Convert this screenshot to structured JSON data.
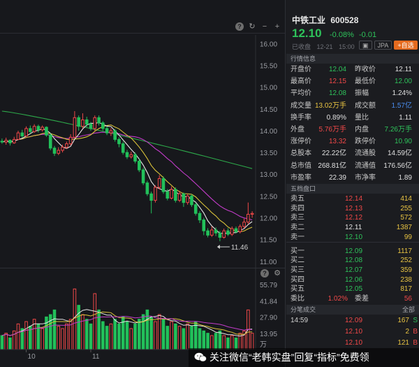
{
  "stock": {
    "name": "中铁工业",
    "code": "600528",
    "price": "12.10",
    "change_pct": "-0.08%",
    "change": "-0.01",
    "status": "已收盘",
    "date": "12-21",
    "time": "15:00",
    "buttons": [
      "JPA",
      "+自选"
    ]
  },
  "quote": {
    "title": "行情信息",
    "rows": [
      {
        "l1": "开盘价",
        "v1": "12.04",
        "c1": "green",
        "l2": "昨收价",
        "v2": "12.11",
        "c2": "white"
      },
      {
        "l1": "最高价",
        "v1": "12.15",
        "c1": "red",
        "l2": "最低价",
        "v2": "12.00",
        "c2": "green"
      },
      {
        "l1": "平均价",
        "v1": "12.08",
        "c1": "green",
        "l2": "振幅",
        "v2": "1.24%",
        "c2": "white"
      },
      {
        "l1": "成交量",
        "v1": "13.02万手",
        "c1": "yellow",
        "l2": "成交额",
        "v2": "1.57亿",
        "c2": "blue"
      },
      {
        "l1": "换手率",
        "v1": "0.89%",
        "c1": "white",
        "l2": "量比",
        "v2": "1.11",
        "c2": "white"
      },
      {
        "l1": "外盘",
        "v1": "5.76万手",
        "c1": "red",
        "l2": "内盘",
        "v2": "7.26万手",
        "c2": "green"
      },
      {
        "l1": "涨停价",
        "v1": "13.32",
        "c1": "red",
        "l2": "跌停价",
        "v2": "10.90",
        "c2": "green"
      },
      {
        "l1": "总股本",
        "v1": "22.22亿",
        "c1": "white",
        "l2": "流通股",
        "v2": "14.59亿",
        "c2": "white"
      },
      {
        "l1": "总市值",
        "v1": "268.81亿",
        "c1": "white",
        "l2": "流通值",
        "v2": "176.56亿",
        "c2": "white"
      },
      {
        "l1": "市盈率",
        "v1": "22.39",
        "c1": "white",
        "l2": "市净率",
        "v2": "1.89",
        "c2": "white"
      }
    ]
  },
  "orderbook": {
    "title": "五档盘口",
    "sell": [
      {
        "label": "卖五",
        "price": "12.14",
        "color": "red",
        "vol": "414"
      },
      {
        "label": "卖四",
        "price": "12.13",
        "color": "red",
        "vol": "255"
      },
      {
        "label": "卖三",
        "price": "12.12",
        "color": "red",
        "vol": "572"
      },
      {
        "label": "卖二",
        "price": "12.11",
        "color": "white",
        "vol": "1387"
      },
      {
        "label": "卖一",
        "price": "12.10",
        "color": "green",
        "vol": "99"
      }
    ],
    "buy": [
      {
        "label": "买一",
        "price": "12.09",
        "color": "green",
        "vol": "1117"
      },
      {
        "label": "买二",
        "price": "12.08",
        "color": "green",
        "vol": "252"
      },
      {
        "label": "买三",
        "price": "12.07",
        "color": "green",
        "vol": "359"
      },
      {
        "label": "买四",
        "price": "12.06",
        "color": "green",
        "vol": "238"
      },
      {
        "label": "买五",
        "price": "12.05",
        "color": "green",
        "vol": "817"
      }
    ],
    "weibi_label": "委比",
    "weibi": "1.02%",
    "weicha_label": "委差",
    "weicha": "56"
  },
  "ticks": {
    "title": "分笔成交",
    "all_label": "全部",
    "rows": [
      {
        "time": "14:59",
        "price": "12.09",
        "pcolor": "red",
        "vol": "167",
        "flag": "S",
        "fcolor": "green"
      },
      {
        "time": "",
        "price": "12.10",
        "pcolor": "red",
        "vol": "2",
        "flag": "B",
        "fcolor": "red"
      },
      {
        "time": "",
        "price": "12.10",
        "pcolor": "red",
        "vol": "121",
        "flag": "B",
        "fcolor": "red"
      }
    ]
  },
  "chart": {
    "price_axis": [
      "16.00",
      "15.50",
      "15.00",
      "14.50",
      "14.00",
      "13.50",
      "13.00",
      "12.50",
      "12.00",
      "11.50",
      "11.00"
    ],
    "min_label": "11.46",
    "vol_axis": [
      "55.79",
      "41.84",
      "27.90",
      "13.95",
      "万"
    ],
    "date_labels": [
      "10",
      "11"
    ]
  },
  "chart_data": {
    "type": "candlestick",
    "ylim": [
      10.9,
      16.2
    ],
    "candles": [
      [
        13.76,
        13.74,
        13.82,
        13.7
      ],
      [
        13.74,
        13.78,
        13.84,
        13.68
      ],
      [
        13.78,
        13.72,
        13.8,
        13.66
      ],
      [
        13.72,
        13.8,
        13.86,
        13.7
      ],
      [
        13.8,
        13.95,
        14.0,
        13.78
      ],
      [
        13.95,
        13.88,
        14.02,
        13.84
      ],
      [
        13.88,
        14.05,
        14.1,
        13.86
      ],
      [
        14.05,
        13.98,
        14.12,
        13.94
      ],
      [
        13.98,
        14.1,
        14.15,
        13.95
      ],
      [
        14.1,
        14.02,
        14.14,
        13.96
      ],
      [
        14.02,
        14.08,
        14.12,
        13.98
      ],
      [
        14.08,
        13.9,
        14.1,
        13.86
      ],
      [
        13.9,
        13.6,
        13.94,
        13.55
      ],
      [
        13.6,
        13.48,
        13.65,
        13.42
      ],
      [
        13.48,
        13.55,
        13.62,
        13.44
      ],
      [
        13.55,
        13.62,
        13.68,
        13.5
      ],
      [
        13.62,
        13.7,
        13.75,
        13.58
      ],
      [
        13.7,
        13.85,
        13.92,
        13.66
      ],
      [
        13.85,
        14.3,
        14.45,
        13.82
      ],
      [
        14.3,
        14.1,
        14.35,
        14.0
      ],
      [
        14.1,
        14.25,
        14.4,
        14.05
      ],
      [
        14.25,
        14.15,
        14.32,
        14.08
      ],
      [
        14.15,
        14.05,
        14.2,
        14.0
      ],
      [
        14.05,
        14.3,
        14.35,
        14.0
      ],
      [
        14.3,
        14.18,
        14.35,
        14.12
      ],
      [
        14.18,
        14.05,
        14.22,
        14.0
      ],
      [
        14.05,
        13.95,
        14.1,
        13.9
      ],
      [
        13.95,
        14.0,
        14.06,
        13.88
      ],
      [
        14.0,
        13.8,
        14.04,
        13.75
      ],
      [
        13.8,
        13.7,
        13.85,
        13.62
      ],
      [
        13.7,
        13.5,
        13.75,
        13.45
      ],
      [
        13.5,
        13.4,
        13.56,
        13.35
      ],
      [
        13.4,
        13.45,
        13.52,
        13.36
      ],
      [
        13.45,
        13.3,
        13.5,
        13.25
      ],
      [
        13.3,
        13.1,
        13.35,
        13.05
      ],
      [
        13.1,
        12.8,
        13.15,
        12.75
      ],
      [
        12.8,
        12.55,
        12.85,
        12.5
      ],
      [
        12.55,
        12.4,
        12.6,
        12.1
      ],
      [
        12.4,
        12.7,
        12.75,
        12.35
      ],
      [
        12.7,
        12.9,
        12.98,
        12.65
      ],
      [
        12.9,
        12.6,
        12.95,
        12.55
      ],
      [
        12.6,
        12.45,
        12.66,
        12.4
      ],
      [
        12.45,
        12.65,
        12.72,
        12.42
      ],
      [
        12.65,
        12.4,
        12.7,
        12.35
      ],
      [
        12.4,
        12.55,
        12.62,
        12.36
      ],
      [
        12.55,
        12.35,
        12.58,
        12.25
      ],
      [
        12.35,
        12.5,
        12.55,
        12.3
      ],
      [
        12.5,
        12.3,
        12.54,
        12.25
      ],
      [
        12.3,
        12.1,
        12.34,
        12.05
      ],
      [
        12.1,
        11.95,
        12.15,
        11.88
      ],
      [
        11.95,
        11.7,
        12.0,
        11.6
      ],
      [
        11.7,
        11.6,
        11.76,
        11.55
      ],
      [
        11.6,
        11.72,
        11.8,
        11.56
      ],
      [
        11.72,
        11.65,
        11.78,
        11.58
      ],
      [
        11.65,
        11.55,
        11.7,
        11.46
      ],
      [
        11.55,
        11.7,
        11.75,
        11.52
      ],
      [
        11.7,
        11.62,
        11.76,
        11.58
      ],
      [
        11.62,
        11.75,
        11.8,
        11.58
      ],
      [
        11.75,
        11.68,
        11.8,
        11.64
      ],
      [
        11.68,
        11.8,
        11.85,
        11.64
      ],
      [
        11.8,
        11.9,
        11.98,
        11.76
      ],
      [
        11.9,
        12.08,
        12.35,
        11.85
      ],
      [
        12.08,
        12.1,
        12.15,
        12.0
      ]
    ],
    "volumes": [
      12,
      14,
      10,
      16,
      22,
      18,
      24,
      20,
      26,
      22,
      18,
      28,
      30,
      34,
      20,
      18,
      22,
      26,
      52,
      38,
      30,
      26,
      22,
      48,
      34,
      24,
      20,
      22,
      26,
      22,
      28,
      24,
      18,
      22,
      26,
      30,
      34,
      28,
      24,
      30,
      26,
      20,
      24,
      22,
      20,
      18,
      22,
      20,
      24,
      18,
      16,
      14,
      12,
      14,
      16,
      12,
      10,
      12,
      10,
      14,
      16,
      34,
      14
    ],
    "xlabel": "",
    "ylabel": ""
  },
  "watermark": {
    "text": "关注微信“老韩实盘”回复“指标”免费领"
  }
}
